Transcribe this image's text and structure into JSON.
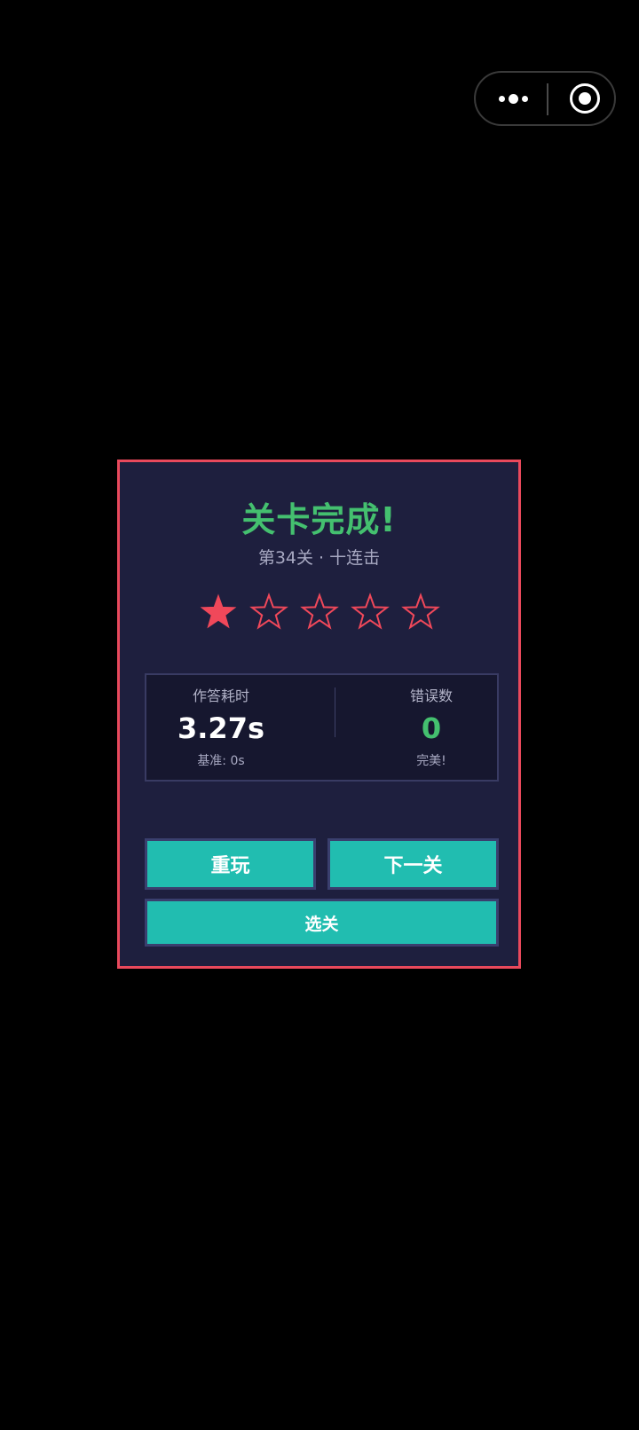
{
  "capsule": {
    "more_icon": "more-dots-icon",
    "close_icon": "target-circle-icon"
  },
  "result": {
    "title": "关卡完成!",
    "subtitle": "第34关 · 十连击",
    "stars": {
      "earned": 1,
      "total": 5
    },
    "time": {
      "label": "作答耗时",
      "value": "3.27s",
      "baseline": "基准: 0s"
    },
    "errors": {
      "label": "错误数",
      "value": "0",
      "comment": "完美!"
    },
    "buttons": {
      "replay": "重玩",
      "next": "下一关",
      "select": "选关"
    }
  },
  "colors": {
    "background": "#000000",
    "panel_bg": "#1e1f3e",
    "panel_border": "#e9495c",
    "title_green": "#44c06f",
    "star_red": "#f0485a",
    "button_teal": "#21bdb0"
  }
}
